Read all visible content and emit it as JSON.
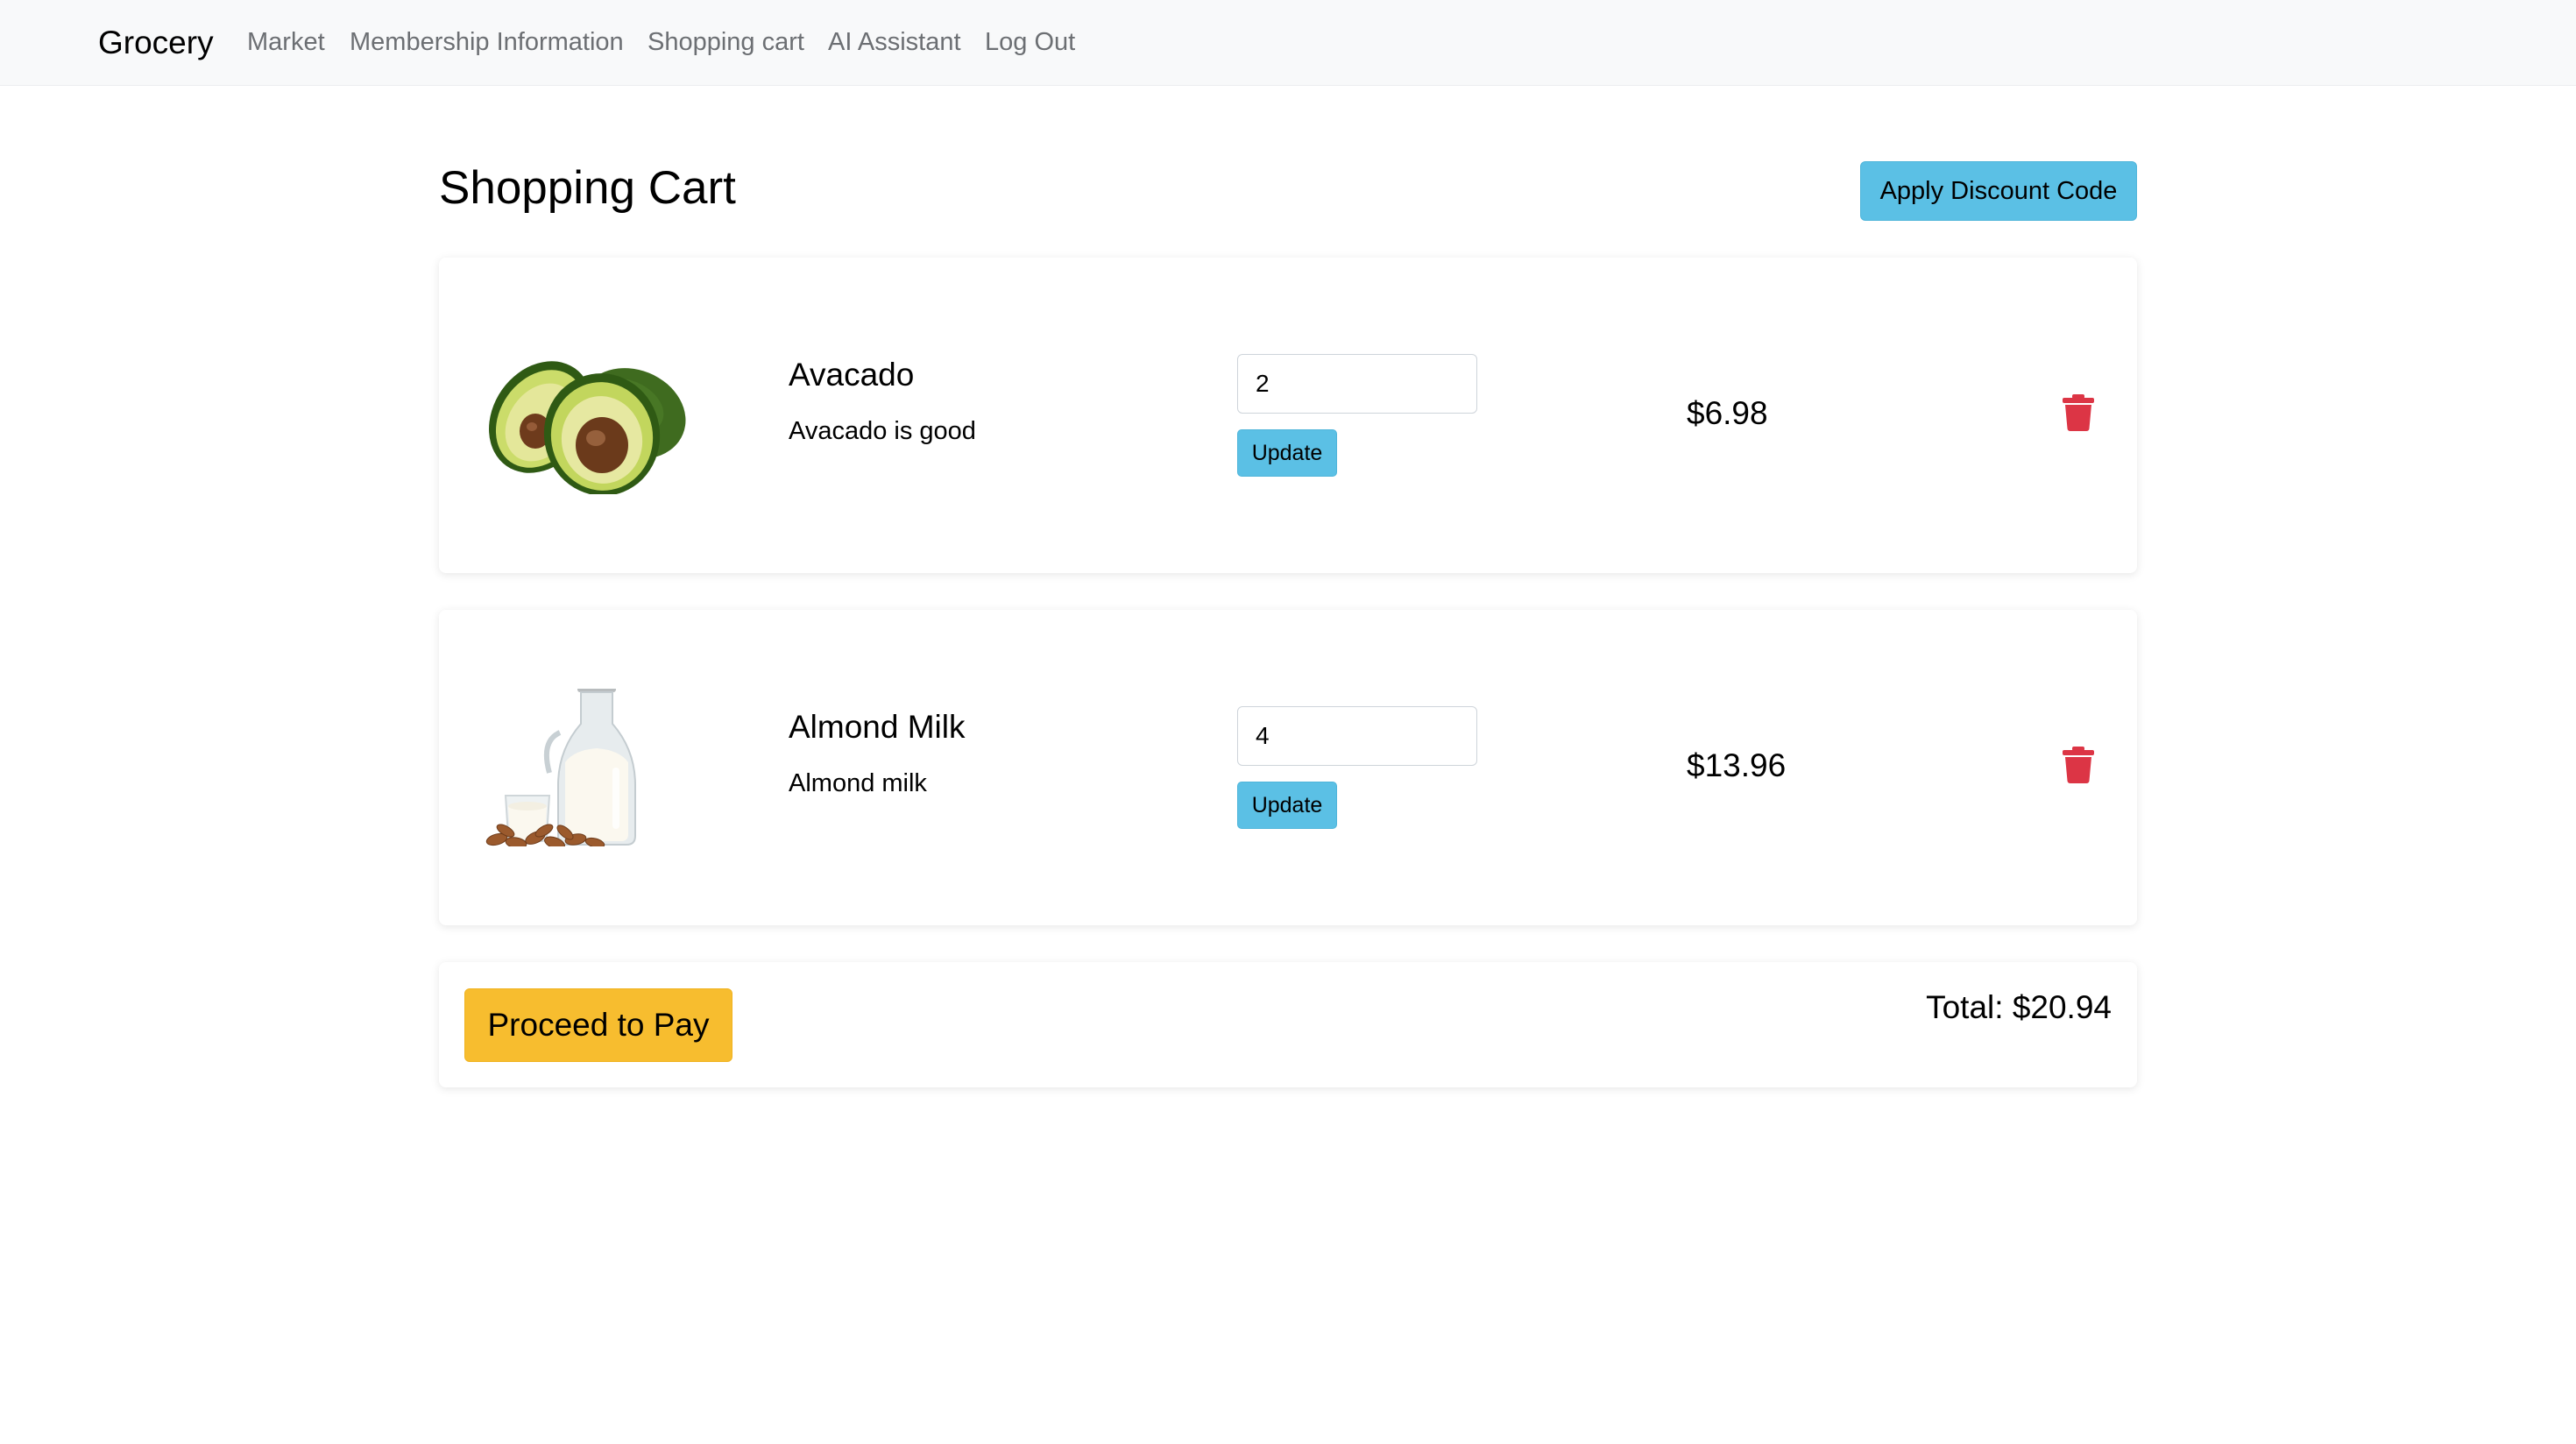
{
  "navbar": {
    "brand": "Grocery",
    "links": [
      "Market",
      "Membership Information",
      "Shopping cart",
      "AI Assistant",
      "Log Out"
    ]
  },
  "header": {
    "title": "Shopping Cart",
    "discount_button": "Apply Discount Code"
  },
  "cart": {
    "items": [
      {
        "name": "Avacado",
        "description": "Avacado is good",
        "quantity": "2",
        "update_label": "Update",
        "price": "$6.98",
        "image_icon": "avocado-image"
      },
      {
        "name": "Almond Milk",
        "description": "Almond milk",
        "quantity": "4",
        "update_label": "Update",
        "price": "$13.96",
        "image_icon": "almond-milk-image"
      }
    ]
  },
  "checkout": {
    "pay_button": "Proceed to Pay",
    "total": "Total: $20.94"
  },
  "colors": {
    "navbar_bg": "#f8f9fa",
    "info_button": "#5bc0e5",
    "pay_button": "#f7bd2f",
    "delete_icon": "#dc3545"
  }
}
